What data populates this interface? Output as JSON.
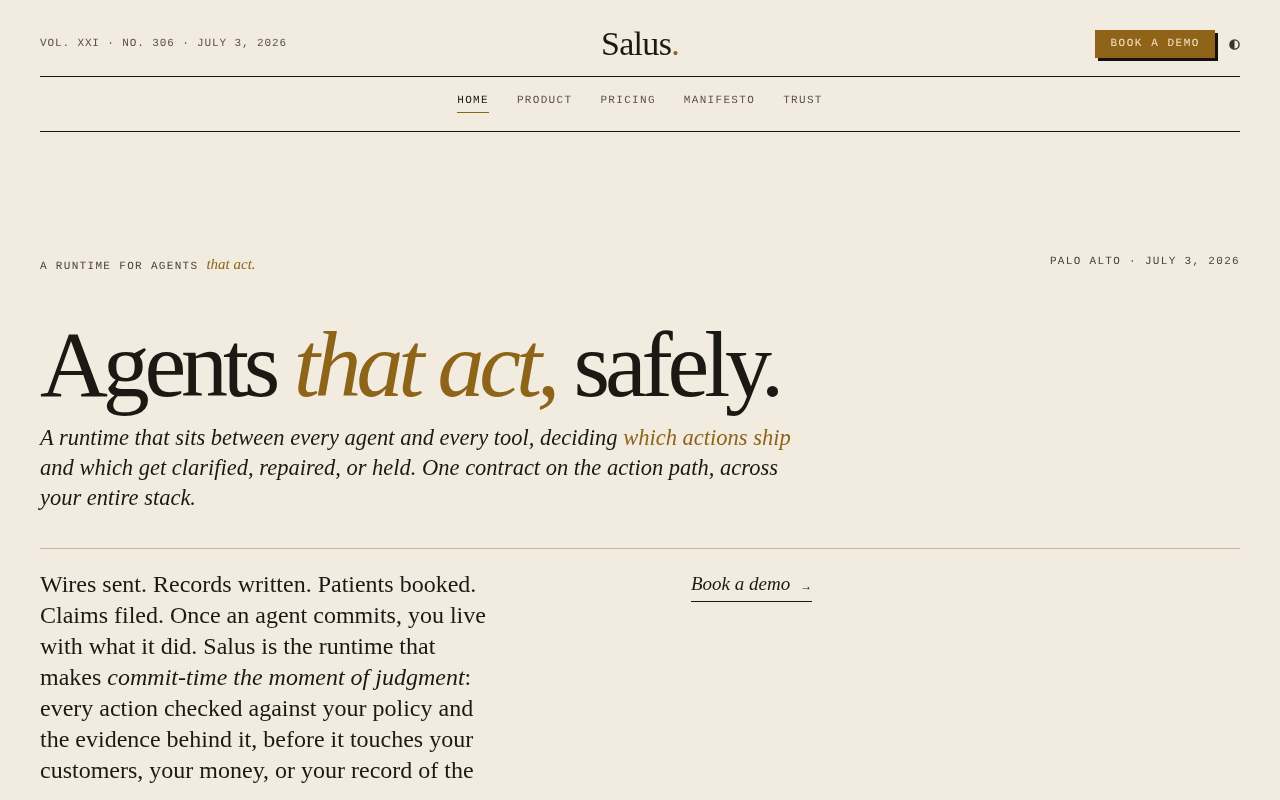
{
  "masthead": {
    "issue_line": "VOL. XXI · NO. 306 · JULY 3, 2026",
    "logo": {
      "name": "Salus",
      "mark": "."
    },
    "cta_button": "BOOK A DEMO"
  },
  "nav": {
    "items": [
      {
        "label": "HOME",
        "selected": true
      },
      {
        "label": "PRODUCT",
        "selected": false
      },
      {
        "label": "PRICING",
        "selected": false
      },
      {
        "label": "MANIFESTO",
        "selected": false
      },
      {
        "label": "TRUST",
        "selected": false
      }
    ]
  },
  "hero": {
    "eyebrow": {
      "label": "A RUNTIME FOR AGENTS",
      "accent": "that act."
    },
    "dateline": "PALO ALTO · JULY 3, 2026",
    "headline": [
      {
        "text": "Agents ",
        "accent": false
      },
      {
        "text": "that act,",
        "accent": true
      },
      {
        "text": " safely.",
        "accent": false
      }
    ],
    "subtitle": [
      {
        "text": "A runtime that sits between every agent and every tool, deciding ",
        "accent": false
      },
      {
        "text": "which actions ship",
        "accent": true
      },
      {
        "text": " and which get clarified, repaired, or held. One contract on the action path, across your entire stack.",
        "accent": false
      }
    ]
  },
  "intro": {
    "body": "Wires sent. Records written. Patients booked. Claims filed. Once an agent commits, you live with what it did. Salus is the runtime that makes *commit-time the moment of judgment*: every action checked against your policy and the evidence behind it, before it touches your customers, your money, or your record of the",
    "link": {
      "label": "Book a demo",
      "arrow": "→"
    }
  }
}
